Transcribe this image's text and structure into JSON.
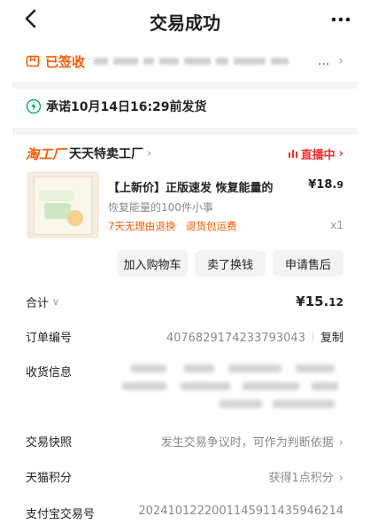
{
  "nav": {
    "title": "交易成功"
  },
  "status": {
    "signed_label": "已签收",
    "ellipsis": "..."
  },
  "promise": {
    "text": "承诺10月14日16:29前发货"
  },
  "shop": {
    "brand": "淘工厂",
    "name": "天天特卖工厂",
    "live": "直播中"
  },
  "product": {
    "title": "【上新价】正版速发 恢复能量的",
    "price_main": "¥18.",
    "price_small": "9",
    "subtitle": "恢复能量的100件小事",
    "tags": [
      "7天无理由退换",
      "退货包运费"
    ],
    "qty": "x1"
  },
  "actions": [
    "加入购物车",
    "卖了换钱",
    "申请售后"
  ],
  "order": {
    "total_label": "合计",
    "total_main": "¥15.",
    "total_small": "12",
    "order_no_label": "订单编号",
    "order_no": "4076829174233793043",
    "copy": "复制",
    "address_label": "收货信息",
    "snapshot_label": "交易快照",
    "snapshot_value": "发生交易争议时，可作为判断依据",
    "tmall_label": "天猫积分",
    "tmall_value": "获得1点积分",
    "alipay_label": "支付宝交易号",
    "alipay_value": "2024101222001145911435946214"
  },
  "colors": {
    "accent": "#ff5a00",
    "live": "#ff2a2a",
    "promise_icon": "#19b36b",
    "muted": "#8a8a8a"
  }
}
